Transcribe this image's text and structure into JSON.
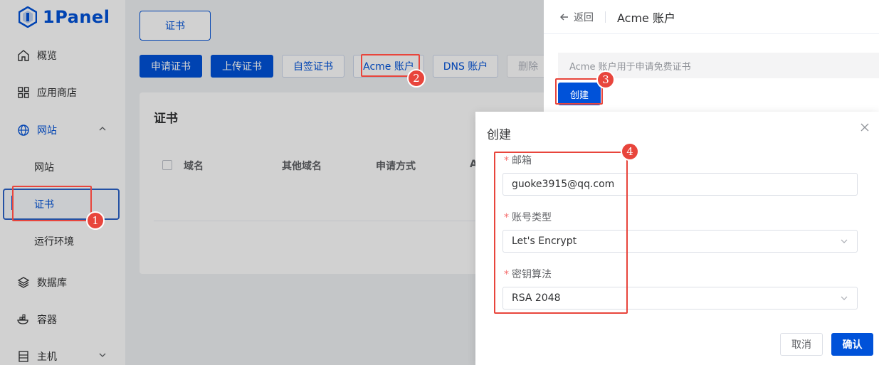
{
  "app": {
    "logo_text": "1Panel"
  },
  "sidebar": {
    "items": [
      {
        "label": "概览",
        "icon": "home-icon"
      },
      {
        "label": "应用商店",
        "icon": "grid-icon"
      },
      {
        "label": "网站",
        "icon": "globe-icon"
      },
      {
        "label": "网站"
      },
      {
        "label": "证书"
      },
      {
        "label": "运行环境"
      },
      {
        "label": "数据库",
        "icon": "layers-icon"
      },
      {
        "label": "容器",
        "icon": "container-icon"
      },
      {
        "label": "主机",
        "icon": "server-icon"
      }
    ]
  },
  "main": {
    "tab": "证书",
    "toolbar": {
      "apply": "申请证书",
      "upload": "上传证书",
      "self_signed": "自签证书",
      "acme": "Acme 账户",
      "dns": "DNS 账户",
      "delete": "删除"
    },
    "card_title": "证书",
    "columns": [
      "域名",
      "其他域名",
      "申请方式",
      "A"
    ]
  },
  "drawer": {
    "back": "返回",
    "title": "Acme 账户",
    "info": "Acme 账户用于申请免费证书",
    "create": "创建"
  },
  "dialog": {
    "title": "创建",
    "email_label": "邮箱",
    "email_value": "guoke3915@qq.com",
    "type_label": "账号类型",
    "type_value": "Let's Encrypt",
    "key_label": "密钥算法",
    "key_value": "RSA 2048",
    "required_mark": "*",
    "cancel": "取消",
    "confirm": "确认"
  },
  "annotations": [
    "1",
    "2",
    "3",
    "4"
  ],
  "colors": {
    "primary": "#0052d9",
    "annotation": "#e8453c"
  }
}
